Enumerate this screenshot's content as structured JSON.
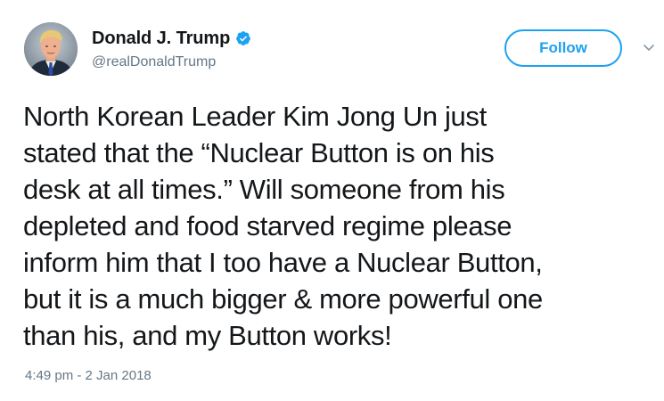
{
  "author": {
    "display_name": "Donald J. Trump",
    "handle": "@realDonaldTrump",
    "verified": true
  },
  "follow_button": {
    "label": "Follow"
  },
  "tweet": {
    "lines": [
      "North Korean Leader Kim Jong Un just",
      "stated that the “Nuclear Button is on his",
      "desk at all times.” Will someone from his",
      "depleted and food starved regime please",
      "inform him that I too have a Nuclear Button,",
      "but it is a much bigger & more powerful one",
      "than his, and my Button works!"
    ],
    "timestamp": "4:49 pm - 2 Jan 2018"
  },
  "icons": {
    "verified": "verified-badge-icon",
    "menu": "chevron-down-icon",
    "avatar": "profile-photo"
  },
  "colors": {
    "accent": "#1da1f2",
    "secondary_text": "#657786",
    "primary_text": "#14171a"
  }
}
